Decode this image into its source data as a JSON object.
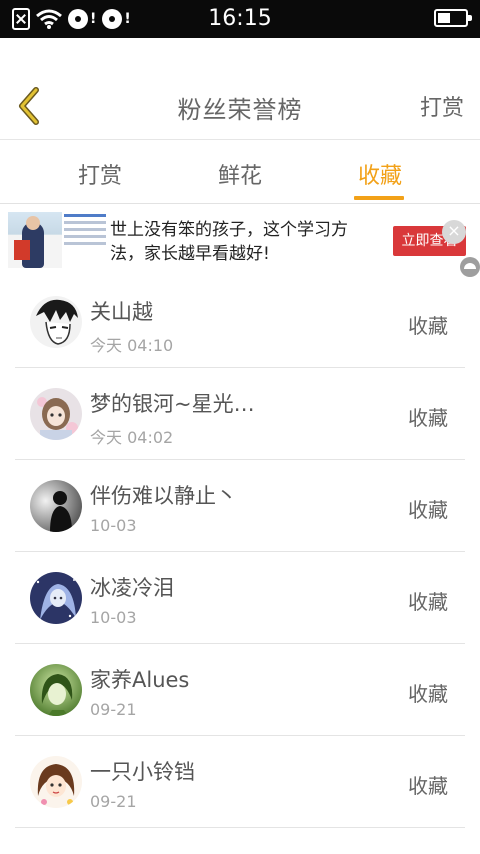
{
  "status_bar": {
    "time": "16:15"
  },
  "header": {
    "title": "粉丝荣誉榜",
    "action": "打赏"
  },
  "tabs": [
    {
      "label": "打赏",
      "active": false
    },
    {
      "label": "鲜花",
      "active": false
    },
    {
      "label": "收藏",
      "active": true
    }
  ],
  "ad": {
    "text": "世上没有笨的孩子，这个学习方法，家长越早看越好!",
    "button": "立即查看",
    "close": "×"
  },
  "colors": {
    "accent": "#f2a118",
    "ad_button": "#d9383a"
  },
  "fans": [
    {
      "name": "关山越",
      "time": "今天 04:10",
      "action": "收藏",
      "avatar": "anime-sketch-avatar"
    },
    {
      "name": "梦的银河~星光…",
      "time": "今天 04:02",
      "action": "收藏",
      "avatar": "anime-girl-avatar"
    },
    {
      "name": "伴伤难以静止丶",
      "time": "10-03",
      "action": "收藏",
      "avatar": "silhouette-avatar"
    },
    {
      "name": "冰凌冷泪",
      "time": "10-03",
      "action": "收藏",
      "avatar": "blue-anime-avatar"
    },
    {
      "name": "家养Alues",
      "time": "09-21",
      "action": "收藏",
      "avatar": "green-portrait-avatar"
    },
    {
      "name": "一只小铃铛",
      "time": "09-21",
      "action": "收藏",
      "avatar": "cartoon-girl-avatar"
    }
  ]
}
